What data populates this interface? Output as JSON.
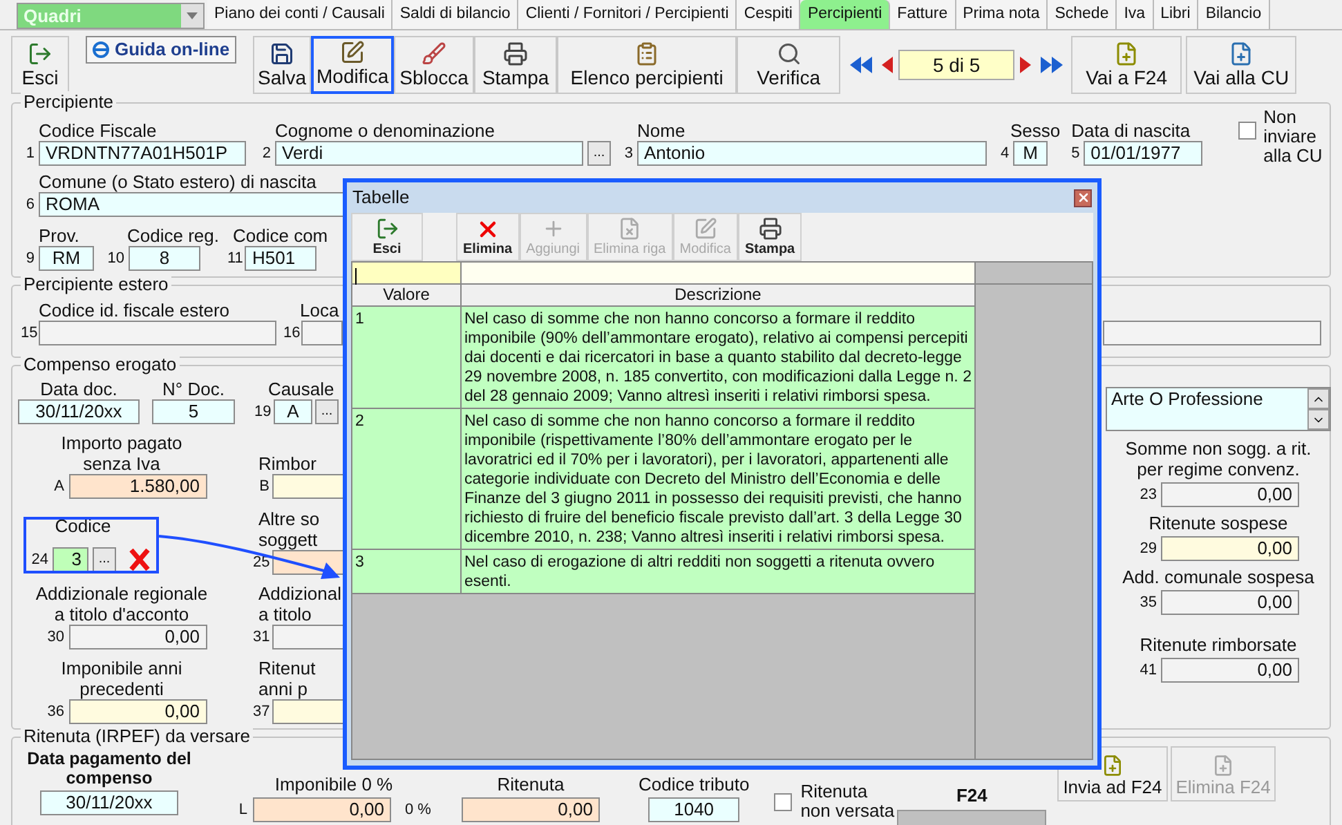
{
  "module_select": {
    "value": "Quadri"
  },
  "tabs": [
    {
      "label": "Piano dei conti / Causali",
      "selected": false
    },
    {
      "label": "Saldi di bilancio",
      "selected": false
    },
    {
      "label": "Clienti / Fornitori / Percipienti",
      "selected": false
    },
    {
      "label": "Cespiti",
      "selected": false
    },
    {
      "label": "Percipienti",
      "selected": true
    },
    {
      "label": "Fatture",
      "selected": false
    },
    {
      "label": "Prima nota",
      "selected": false
    },
    {
      "label": "Schede",
      "selected": false
    },
    {
      "label": "Iva",
      "selected": false
    },
    {
      "label": "Libri",
      "selected": false
    },
    {
      "label": "Bilancio",
      "selected": false
    }
  ],
  "toolbar": {
    "exit": "Esci",
    "help": "Guida on-line",
    "buttons": [
      {
        "label": "Salva",
        "kind": "save",
        "selected": false
      },
      {
        "label": "Modifica",
        "kind": "edit",
        "selected": true
      },
      {
        "label": "Sblocca",
        "kind": "unlock",
        "selected": false
      },
      {
        "label": "Stampa",
        "kind": "print",
        "selected": false
      },
      {
        "label": "Elenco percipienti",
        "kind": "list",
        "selected": false
      },
      {
        "label": "Verifica",
        "kind": "search",
        "selected": false
      }
    ],
    "record": "5 di 5",
    "right_buttons": [
      {
        "label": "Vai a F24",
        "kind": "f24"
      },
      {
        "label": "Vai alla CU",
        "kind": "cu"
      }
    ]
  },
  "percipiente": {
    "title": "Percipiente",
    "codice_fiscale": {
      "label": "Codice Fiscale",
      "num": "1",
      "value": "VRDNTN77A01H501P",
      "kind": "cyan"
    },
    "cognome": {
      "label": "Cognome o denominazione",
      "num": "2",
      "value": "Verdi",
      "kind": "cyan",
      "button": "..."
    },
    "nome": {
      "label": "Nome",
      "num": "3",
      "value": "Antonio",
      "kind": "cyan"
    },
    "sesso": {
      "label": "Sesso",
      "num": "4",
      "value": "M",
      "kind": "cyan"
    },
    "data_nascita": {
      "label": "Data di nascita",
      "num": "5",
      "value": "01/01/1977",
      "kind": "cyan"
    },
    "non_inviare": {
      "label": "Non inviare alla CU",
      "checked": false
    },
    "comune": {
      "label": "Comune (o Stato estero) di nascita",
      "num": "6",
      "value": "ROMA",
      "kind": "cyan"
    },
    "prov": {
      "label": "Prov.",
      "num": "9",
      "value": "RM",
      "kind": "cyan"
    },
    "codice_reg": {
      "label": "Codice reg.",
      "num": "10",
      "value": "8",
      "kind": "cyan"
    },
    "codice_com": {
      "label": "Codice com",
      "num": "11",
      "value": "H501",
      "kind": "cyan"
    }
  },
  "percipiente_estero": {
    "title": "Percipiente estero",
    "codice_id": {
      "label": "Codice id. fiscale estero",
      "num": "15",
      "kind": "plain"
    },
    "localita": {
      "label": "Loca",
      "num": "16",
      "kind": "plain"
    }
  },
  "compenso": {
    "title": "Compenso erogato",
    "data_doc": {
      "label": "Data doc.",
      "value": "30/11/20xx",
      "kind": "cyan"
    },
    "n_doc": {
      "label": "N° Doc.",
      "value": "5",
      "kind": "cyan"
    },
    "causale": {
      "label": "Causale",
      "num": "19",
      "value": "A",
      "kind": "cyan",
      "button": "..."
    },
    "causale_desc": {
      "value": "Arte O Professione"
    },
    "left": [
      {
        "label": "Importo pagato senza Iva",
        "num": "A",
        "value": "1.580,00",
        "kind": "peach"
      },
      {
        "label": "Codice",
        "num": "24",
        "value": "3",
        "kind": "green",
        "button": "..."
      },
      {
        "label": "Addizionale regionale a titolo d'acconto",
        "num": "30",
        "value": "0,00",
        "kind": "plain"
      },
      {
        "label": "Imponibile anni precedenti",
        "num": "36",
        "value": "0,00",
        "kind": "yellow"
      }
    ],
    "middle": [
      {
        "label": "Rimbor",
        "num": "B",
        "kind": "yellow"
      },
      {
        "label": "Altre so soggett",
        "num": "25",
        "kind": "peach"
      },
      {
        "label": "Addizional a titolo",
        "num": "31",
        "kind": "plain"
      },
      {
        "label": "Ritenut anni p",
        "num": "37",
        "kind": "yellow"
      }
    ],
    "right": [
      {
        "label": "Somme non sogg. a rit. per regime convenz.",
        "num": "23",
        "value": "0,00",
        "kind": "plain"
      },
      {
        "label": "Ritenute sospese",
        "num": "29",
        "value": "0,00",
        "kind": "yellow"
      },
      {
        "label": "Add. comunale sospesa",
        "num": "35",
        "value": "0,00",
        "kind": "plain"
      },
      {
        "label": "Ritenute rimborsate",
        "num": "41",
        "value": "0,00",
        "kind": "plain"
      }
    ]
  },
  "ritenuta": {
    "title": "Ritenuta (IRPEF) da versare",
    "data_pagamento": {
      "label": "Data pagamento del compenso",
      "value": "30/11/20xx",
      "kind": "cyan"
    },
    "imponibile": {
      "label": "Imponibile 0 %",
      "num": "L",
      "value": "0,00",
      "kind": "peach",
      "suffix": "0 %"
    },
    "ritenuta": {
      "label": "Ritenuta",
      "value": "0,00",
      "kind": "peach"
    },
    "codice_tributo": {
      "label": "Codice tributo",
      "value": "1040",
      "kind": "cyan"
    },
    "non_versata": {
      "label": "Ritenuta non versata",
      "checked": false
    },
    "f24": {
      "label": "F24"
    },
    "buttons": [
      {
        "label": "Invia ad F24",
        "disabled": false
      },
      {
        "label": "Elimina F24",
        "disabled": true
      }
    ]
  },
  "dialog": {
    "title": "Tabelle",
    "buttons": [
      {
        "label": "Esci",
        "kind": "exit",
        "disabled": false
      },
      {
        "label": "Elimina",
        "kind": "delete",
        "disabled": false
      },
      {
        "label": "Aggiungi",
        "kind": "add",
        "disabled": true
      },
      {
        "label": "Elimina riga",
        "kind": "delete_row",
        "disabled": true
      },
      {
        "label": "Modifica",
        "kind": "edit",
        "disabled": true
      },
      {
        "label": "Stampa",
        "kind": "print",
        "disabled": false
      }
    ],
    "columns": [
      "Valore",
      "Descrizione"
    ],
    "rows": [
      {
        "value": "1",
        "description": "Nel caso di somme che non hanno concorso a formare il reddito imponibile (90% dell’ammontare erogato), relativo ai compensi percepiti dai docenti e dai ricercatori in base a quanto stabilito dal decreto-legge 29 novembre 2008, n. 185 convertito, con modificazioni dalla Legge n. 2 del 28 gennaio 2009; Vanno altresì inseriti i relativi rimborsi spesa."
      },
      {
        "value": "2",
        "description": "Nel caso di somme che non hanno concorso a formare il reddito imponibile (rispettivamente l’80% dell’ammontare erogato per le lavoratrici ed il 70% per i lavoratori), per i lavoratori, appartenenti alle categorie individuate con Decreto del Ministro dell’Economia e delle Finanze del 3 giugno 2011 in possesso dei requisiti previsti, che hanno richiesto di fruire del beneficio fiscale previsto dall’art. 3 della Legge 30 dicembre 2010, n. 238; Vanno altresì inseriti i relativi rimborsi spesa."
      },
      {
        "value": "3",
        "description": "Nel caso di erogazione di altri redditi non soggetti a ritenuta ovvero esenti."
      }
    ]
  }
}
